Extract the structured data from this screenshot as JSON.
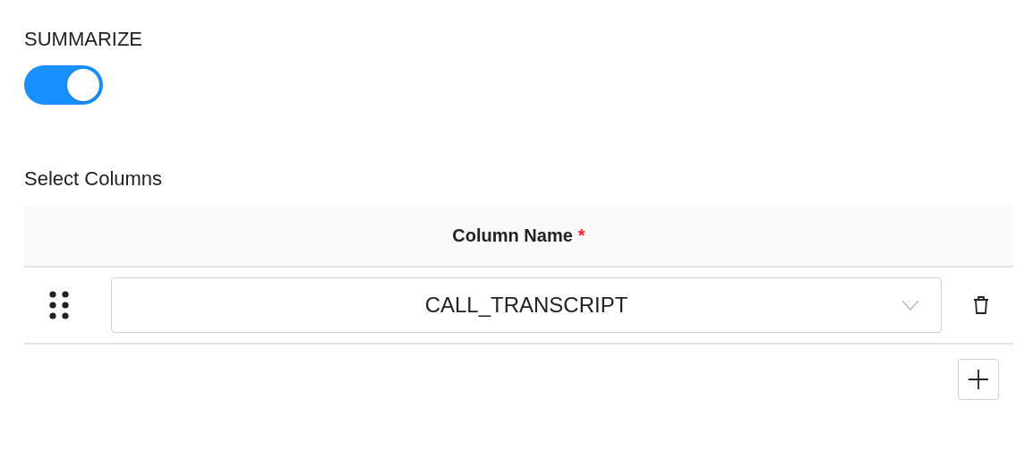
{
  "summarize": {
    "label": "SUMMARIZE",
    "on": true
  },
  "select_columns": {
    "label": "Select Columns",
    "header": {
      "label": "Column Name",
      "required_mark": "*"
    },
    "rows": [
      {
        "value": "CALL_TRANSCRIPT"
      }
    ]
  }
}
